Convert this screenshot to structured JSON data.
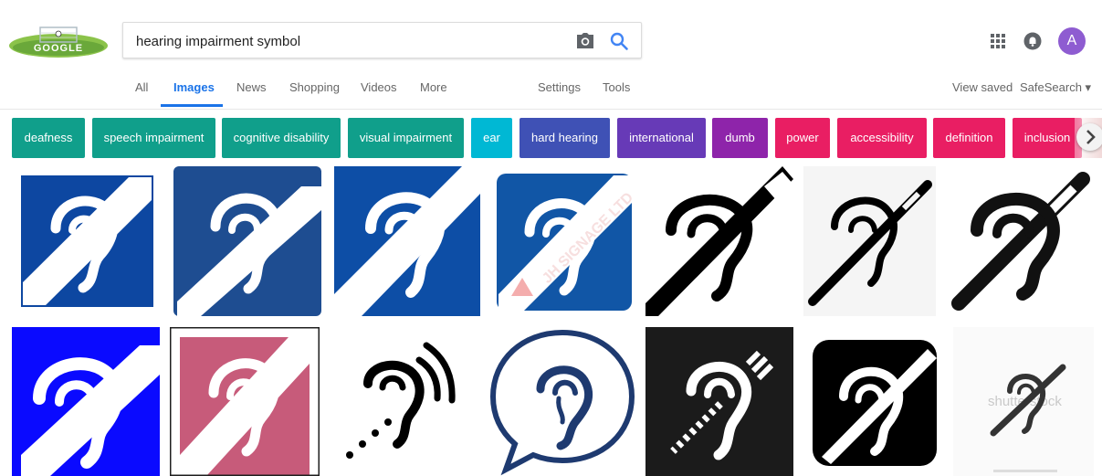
{
  "search": {
    "query": "hearing impairment symbol"
  },
  "account": {
    "avatar_letter": "A"
  },
  "nav": {
    "tabs": [
      "All",
      "Images",
      "News",
      "Shopping",
      "Videos",
      "More"
    ],
    "active_tab": "Images",
    "settings": "Settings",
    "tools": "Tools",
    "view_saved": "View saved",
    "safe_search": "SafeSearch ▾"
  },
  "chips": [
    {
      "label": "deafness",
      "color": "#109f8b"
    },
    {
      "label": "speech impairment",
      "color": "#109f8b"
    },
    {
      "label": "cognitive disability",
      "color": "#109f8b"
    },
    {
      "label": "visual impairment",
      "color": "#109f8b"
    },
    {
      "label": "ear",
      "color": "#00b8d4"
    },
    {
      "label": "hard hearing",
      "color": "#3f51b5"
    },
    {
      "label": "international",
      "color": "#673ab7"
    },
    {
      "label": "dumb",
      "color": "#8e24aa"
    },
    {
      "label": "power",
      "color": "#e91e63"
    },
    {
      "label": "accessibility",
      "color": "#e91e63"
    },
    {
      "label": "definition",
      "color": "#e91e63"
    },
    {
      "label": "inclusion",
      "color": "#e91e63"
    }
  ],
  "watermarks": {
    "jh_signage": "JH SIGNAGE LTD",
    "shutterstock": "shutterstock"
  },
  "colors": {
    "accent": "#1a73e8",
    "sign_blue": "#0d47a1",
    "sign_pink": "#c75b7a"
  }
}
